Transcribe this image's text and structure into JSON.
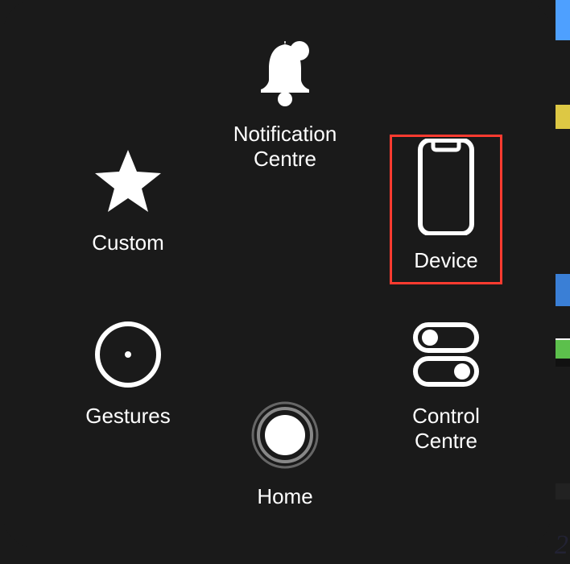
{
  "menu": {
    "notification_centre": {
      "label": "Notification\nCentre"
    },
    "custom": {
      "label": "Custom"
    },
    "device": {
      "label": "Device"
    },
    "gestures": {
      "label": "Gestures"
    },
    "home": {
      "label": "Home"
    },
    "control_centre": {
      "label": "Control\nCentre"
    }
  },
  "highlight": {
    "target": "device",
    "color": "#ff3b30"
  },
  "corner_digit": "2"
}
